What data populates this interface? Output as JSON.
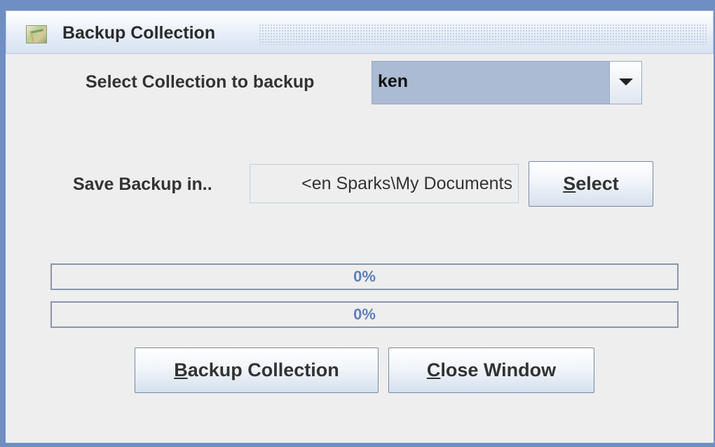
{
  "window": {
    "title": "Backup Collection",
    "icon": "app-image-icon"
  },
  "collection": {
    "label": "Select Collection to backup",
    "selected": "ken",
    "dropdown_icon": "chevron-down-icon"
  },
  "save": {
    "label": "Save Backup in..",
    "path_value": "<en Sparks\\My Documents",
    "select_button": {
      "mnemonic": "S",
      "rest": "elect"
    }
  },
  "progress": [
    {
      "text": "0%",
      "value": 0
    },
    {
      "text": "0%",
      "value": 0
    }
  ],
  "actions": {
    "backup_button": {
      "mnemonic": "B",
      "rest": "ackup Collection"
    },
    "close_button": {
      "mnemonic": "C",
      "rest": "lose Window"
    }
  },
  "colors": {
    "frame": "#6f8fc3",
    "panel": "#eeeeee",
    "combo_selected": "#aabbd3",
    "progress_text": "#5f80b8"
  }
}
